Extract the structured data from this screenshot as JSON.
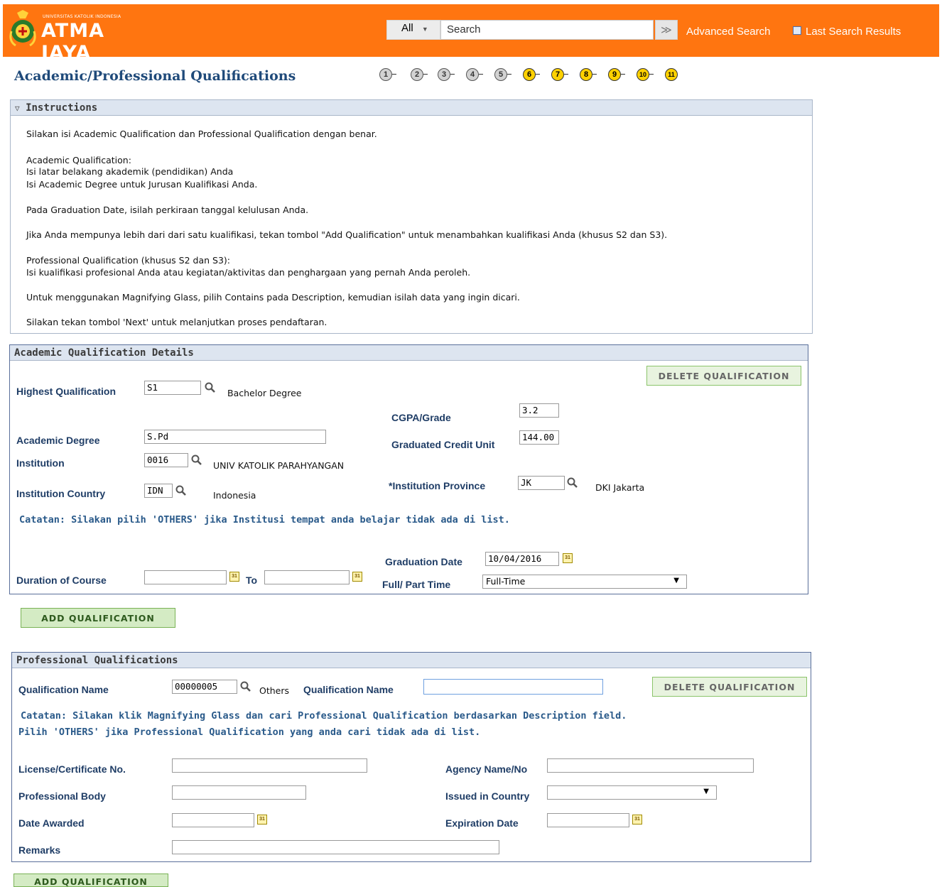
{
  "header": {
    "logo_small": "UNIVERSITAS KATOLIK INDONESIA",
    "logo_big": "ATMA JAYA",
    "search_scope": "All",
    "search_placeholder": "Search",
    "search_go": "≫",
    "advanced_search": "Advanced Search",
    "last_search_results": "Last Search Results",
    "bar_color": "#ff7510"
  },
  "page_title": "Academic/Professional Qualifications",
  "steps": {
    "grey": [
      "1",
      "2",
      "3",
      "4",
      "5"
    ],
    "yellow": [
      "6",
      "7",
      "8",
      "9",
      "10",
      "11"
    ]
  },
  "instructions": {
    "header": "Instructions",
    "lines": [
      "Silakan isi Academic Qualification dan Professional Qualification dengan benar.",
      "Academic Qualification:",
      "Isi latar belakang akademik (pendidikan) Anda",
      "Isi Academic Degree untuk Jurusan Kualifikasi Anda.",
      "Pada Graduation Date, isilah perkiraan tanggal kelulusan Anda.",
      "Jika Anda mempunya lebih dari dari satu kualifikasi, tekan tombol \"Add Qualification\" untuk menambahkan kualifikasi Anda (khusus S2 dan S3).",
      "Professional Qualification (khusus S2 dan S3):",
      "Isi kualifikasi profesional Anda atau kegiatan/aktivitas dan penghargaan yang pernah Anda peroleh.",
      "Untuk menggunakan Magnifying Glass, pilih Contains pada Description, kemudian isilah data yang ingin dicari.",
      "Silakan tekan tombol 'Next' untuk melanjutkan proses pendaftaran."
    ]
  },
  "academic": {
    "header": "Academic Qualification Details",
    "delete_button": "DELETE QUALIFICATION",
    "highest_qualification_label": "Highest Qualification",
    "highest_qualification_value": "S1",
    "highest_qualification_desc": "Bachelor Degree",
    "cgpa_label": "CGPA/Grade",
    "cgpa_value": "3.2",
    "academic_degree_label": "Academic Degree",
    "academic_degree_value": "S.Pd",
    "graduated_credit_label": "Graduated Credit Unit",
    "graduated_credit_value": "144.00",
    "institution_label": "Institution",
    "institution_value": "0016",
    "institution_desc": "UNIV KATOLIK PARAHYANGAN",
    "institution_country_label": "Institution Country",
    "institution_country_value": "IDN",
    "institution_country_desc": "Indonesia",
    "institution_province_label": "*Institution Province",
    "institution_province_value": "JK",
    "institution_province_desc": "DKI Jakarta",
    "note": "Catatan: Silakan pilih 'OTHERS' jika Institusi tempat anda belajar tidak ada di list.",
    "graduation_date_label": "Graduation Date",
    "graduation_date_value": "10/04/2016",
    "duration_label": "Duration of Course",
    "duration_from": "",
    "to_label": "To",
    "duration_to": "",
    "full_part_label": "Full/ Part Time",
    "full_part_value": "Full-Time",
    "add_button": "ADD QUALIFICATION"
  },
  "professional": {
    "header": "Professional Qualifications",
    "qual_name_label": "Qualification Name",
    "qual_name_value": "00000005",
    "qual_name_desc": "Others",
    "qual_name_label2": "Qualification Name",
    "qual_name_text": "",
    "delete_button": "DELETE QUALIFICATION",
    "note_line1": "Catatan: Silakan klik Magnifying Glass dan cari Professional Qualification berdasarkan Description field.",
    "note_line2": "Pilih 'OTHERS' jika Professional Qualification yang anda cari tidak ada di list.",
    "license_label": "License/Certificate No.",
    "license_value": "",
    "agency_label": "Agency Name/No",
    "agency_value": "",
    "prof_body_label": "Professional Body",
    "prof_body_value": "",
    "issued_country_label": "Issued in Country",
    "issued_country_value": "",
    "date_awarded_label": "Date Awarded",
    "date_awarded_value": "",
    "expiration_label": "Expiration Date",
    "expiration_value": "",
    "remarks_label": "Remarks",
    "remarks_value": "",
    "add_button": "ADD QUALIFICATION"
  },
  "icons": {
    "magnifier": "magnifier-icon",
    "calendar": "calendar-icon",
    "calendar_text": "31",
    "collapse": "▽",
    "dropdown": "▼",
    "last_results": "▣"
  }
}
